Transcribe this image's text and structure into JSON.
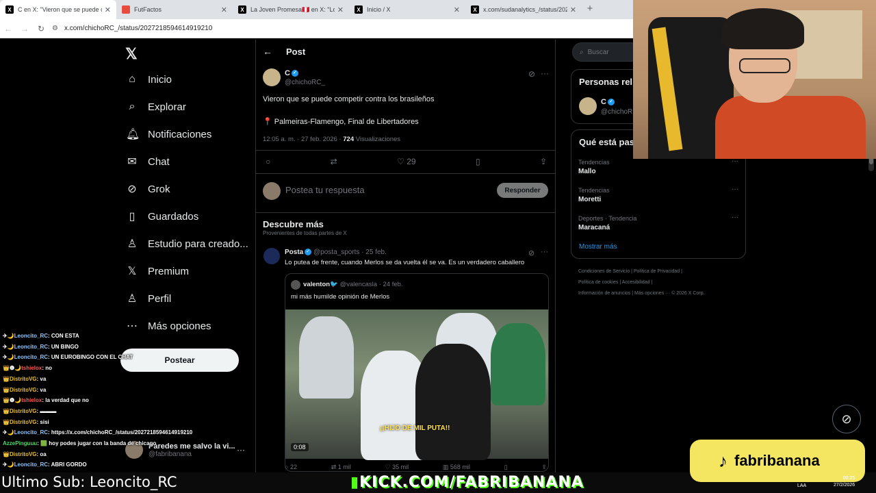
{
  "browser": {
    "tabs": [
      {
        "label": "C en X: \"Vieron que se puede co",
        "favicon": "x-icon",
        "active": true
      },
      {
        "label": "FutFactos",
        "favicon": "futfactos-icon",
        "active": false
      },
      {
        "label": "La Joven Promesa🇵🇪 en X: \"Lo",
        "favicon": "x-icon",
        "active": false
      },
      {
        "label": "Inicio / X",
        "favicon": "x-icon",
        "active": false
      },
      {
        "label": "x.com/sudanalytics_/status/202",
        "favicon": "x-icon",
        "active": false
      }
    ],
    "new_tab": "+",
    "url": "x.com/chichoRC_/status/2027218594614919210"
  },
  "sidebar": {
    "logo": "𝕏",
    "items": [
      {
        "label": "Inicio",
        "icon": "home-icon",
        "glyph": "⌂"
      },
      {
        "label": "Explorar",
        "icon": "search-icon",
        "glyph": "⌕"
      },
      {
        "label": "Notificaciones",
        "icon": "bell-icon",
        "glyph": "♫"
      },
      {
        "label": "Chat",
        "icon": "mail-icon",
        "glyph": "✉"
      },
      {
        "label": "Grok",
        "icon": "grok-icon",
        "glyph": "⊘"
      },
      {
        "label": "Guardados",
        "icon": "bookmark-icon",
        "glyph": "⚑"
      },
      {
        "label": "Estudio para creado...",
        "icon": "studio-icon",
        "glyph": "♙"
      },
      {
        "label": "Premium",
        "icon": "x-premium-icon",
        "glyph": "𝕏"
      },
      {
        "label": "Perfil",
        "icon": "person-icon",
        "glyph": "♙"
      },
      {
        "label": "Más opciones",
        "icon": "more-circle-icon",
        "glyph": "⋯"
      }
    ],
    "post_button": "Postear",
    "account": {
      "name": "Paredes me salvo la vi...",
      "handle": "@fabribanana",
      "more": "···"
    }
  },
  "main": {
    "header_title": "Post",
    "post": {
      "author": "C",
      "handle": "@chichoRC_",
      "text": "Vieron que se puede competir contra los brasileños",
      "line2": "📍 Palmeiras-Flamengo, Final de Libertadores",
      "time": "12:05 a. m. · 27 feb. 2026 ·",
      "views_count": "724",
      "views_label": "Visualizaciones",
      "likes": "29"
    },
    "reply_placeholder": "Postea tu respuesta",
    "reply_button": "Responder",
    "discover_title": "Descubre más",
    "discover_sub": "Provenientes de todas partes de X",
    "feed_post": {
      "author": "Posta",
      "handle": "@posta_sports · 25 feb.",
      "text": "Lo putea de frente, cuando Merlos se da vuelta él se va. Es un verdadero caballero",
      "quote": {
        "author": "valenton🐦",
        "handle": "@valencasla · 24 feb.",
        "text": "mi más humilde opinión de Merlos",
        "caption": "¡¡HIJO DE MIL PUTA!!",
        "duration": "0:08"
      },
      "stats": {
        "replies": "22",
        "reposts": "1 mil",
        "likes": "35 mil",
        "views": "568 mil"
      }
    }
  },
  "right": {
    "search_placeholder": "Buscar",
    "people_title": "Personas rel",
    "person": {
      "name": "C",
      "handle": "@chichoR"
    },
    "trends_title": "Qué está pas",
    "trends": [
      {
        "category": "Tendencias",
        "name": "Mallo"
      },
      {
        "category": "Tendencias",
        "name": "Moretti"
      },
      {
        "category": "Deportes · Tendencia",
        "name": "Maracaná"
      }
    ],
    "show_more": "Mostrar más",
    "footer_row1": [
      "Condiciones de Servicio",
      "|",
      "Política de Privacidad",
      "|"
    ],
    "footer_row2": [
      "Política de cookies",
      "|",
      "Accesibilidad",
      "|"
    ],
    "footer_row3": [
      "Información de anuncios",
      "|",
      "Más opciones ···",
      "© 2026 X Corp."
    ]
  },
  "stream": {
    "chat": [
      {
        "user": "Leoncito_RC",
        "msg": "CON ESTA",
        "cls": "u1",
        "badge": "✈🌙"
      },
      {
        "user": "Leoncito_RC",
        "msg": "UN BINGO",
        "cls": "u1",
        "badge": "✈🌙"
      },
      {
        "user": "Leoncito_RC",
        "msg": "UN EUROBINGO CON EL CHAT",
        "cls": "u1",
        "badge": "✈🌙"
      },
      {
        "user": "tshielox",
        "msg": "no",
        "cls": "u3",
        "badge": "👑❶🌙"
      },
      {
        "user": "DistritoVG",
        "msg": "va",
        "cls": "u2",
        "badge": "👑"
      },
      {
        "user": "DistritoVG",
        "msg": "va",
        "cls": "u2",
        "badge": "👑"
      },
      {
        "user": "tshielox",
        "msg": "la verdad que no",
        "cls": "u3",
        "badge": "👑❶🌙"
      },
      {
        "user": "DistritoVG",
        "msg": "▬▬▬",
        "cls": "u2",
        "badge": "👑"
      },
      {
        "user": "DistritoVG",
        "msg": "sisi",
        "cls": "u2",
        "badge": "👑"
      },
      {
        "user": "Leoncito_RC",
        "msg": "https://x.com/chichoRC_/status/2027218594614919210",
        "cls": "u1",
        "badge": "✈🌙"
      },
      {
        "user": "AzzePinguuu",
        "msg": "🟩 hoy podes jugar con la banda de chicago",
        "cls": "u4",
        "badge": ""
      },
      {
        "user": "DistritoVG",
        "msg": "oa",
        "cls": "u2",
        "badge": "👑"
      },
      {
        "user": "Leoncito_RC",
        "msg": "ABRI GORDO",
        "cls": "u1",
        "badge": "✈🌙"
      }
    ],
    "last_sub": "Ultimo Sub: Leoncito_RC",
    "kick_url": "KICK.COM/FABRIBANANA",
    "tiktok_handle": "fabribanana",
    "clock_time": "00:25",
    "clock_date": "27/2/2026",
    "lang": "LAA"
  }
}
